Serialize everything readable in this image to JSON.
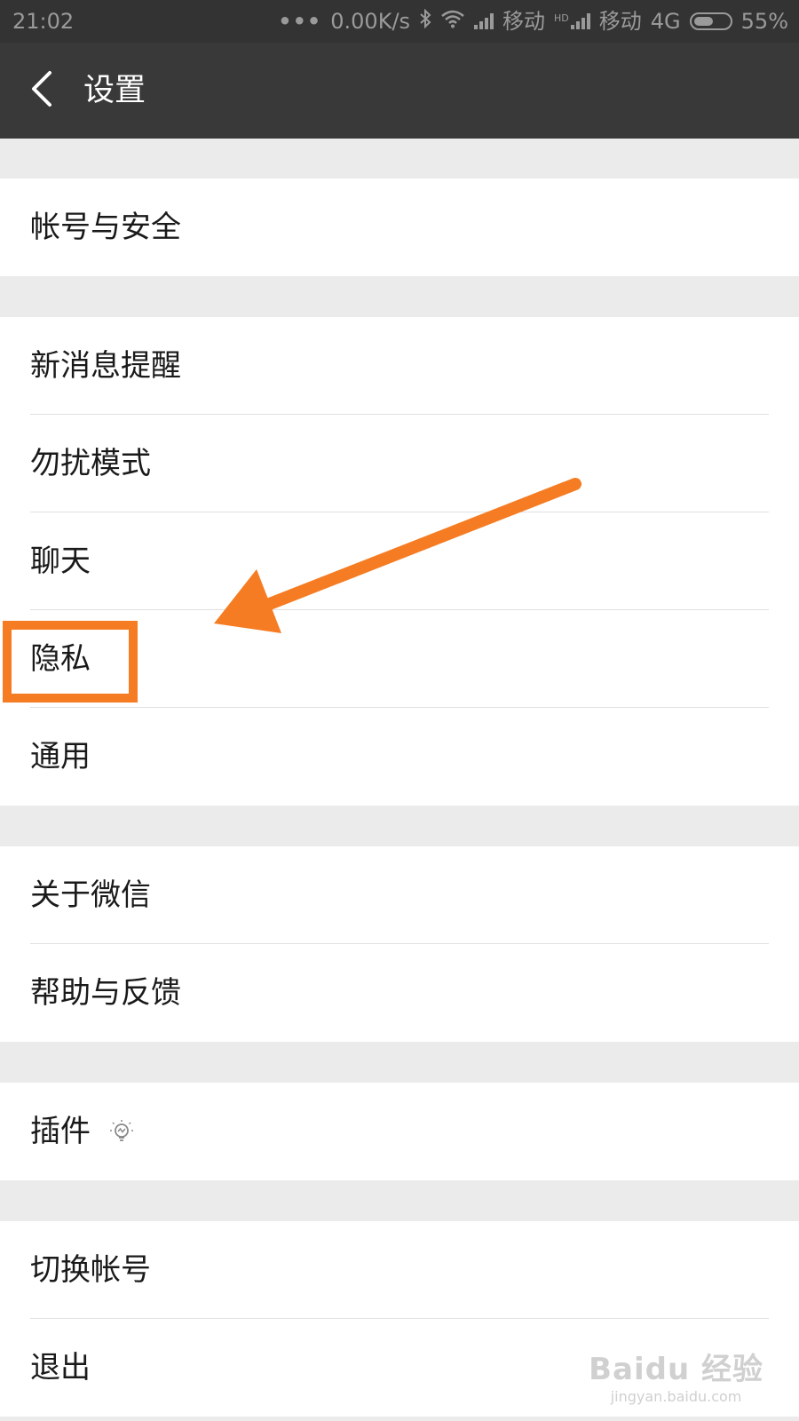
{
  "status_bar": {
    "time": "21:02",
    "dots": "•••",
    "speed": "0.00K/s",
    "carrier1": "移动",
    "hd": "HD",
    "carrier2": "移动",
    "network": "4G",
    "battery": "55%",
    "battery_level": 0.55
  },
  "header": {
    "title": "设置",
    "back_icon": "chevron-left-icon"
  },
  "menu": {
    "group1": [
      {
        "label": "帐号与安全"
      }
    ],
    "group2": [
      {
        "label": "新消息提醒"
      },
      {
        "label": "勿扰模式"
      },
      {
        "label": "聊天"
      },
      {
        "label": "隐私"
      },
      {
        "label": "通用"
      }
    ],
    "group3": [
      {
        "label": "关于微信"
      },
      {
        "label": "帮助与反馈"
      }
    ],
    "group4": [
      {
        "label": "插件",
        "icon": "lightbulb-icon"
      }
    ],
    "group5": [
      {
        "label": "切换帐号"
      },
      {
        "label": "退出"
      }
    ]
  },
  "annotation": {
    "highlighted_item": "隐私",
    "color": "#f57c22"
  },
  "watermark": {
    "main": "Baidu 经验",
    "sub": "jingyan.baidu.com"
  },
  "colors": {
    "header_bg": "#393939",
    "status_bg": "#333333",
    "page_bg": "#ebebeb",
    "accent": "#f57c22"
  }
}
